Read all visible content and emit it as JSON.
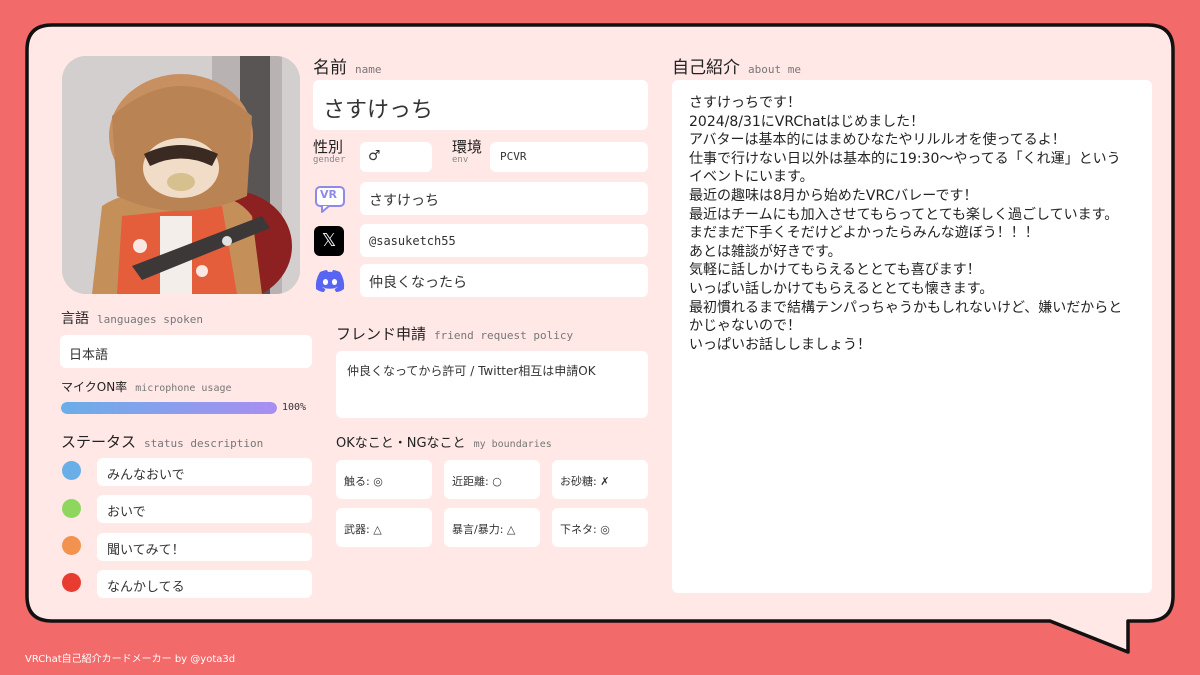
{
  "profile": {
    "name_label": "名前",
    "name_label_en": "name",
    "name_value": "さすけっち",
    "gender_label": "性別",
    "gender_label_en": "gender",
    "gender_value": "♂",
    "env_label": "環境",
    "env_label_en": "env",
    "env_value": "PCVR",
    "vrchat_icon_text": "VR",
    "vrchat_name": "さすけっち",
    "x_icon_text": "𝕏",
    "twitter_handle": "@sasuketch55",
    "discord_value": "仲良くなったら"
  },
  "languages": {
    "label": "言語",
    "label_en": "languages spoken",
    "value": "日本語"
  },
  "microphone": {
    "label": "マイクON率",
    "label_en": "microphone usage",
    "percent": 100,
    "percent_text": "100%"
  },
  "status": {
    "label": "ステータス",
    "label_en": "status description",
    "items": [
      {
        "text": "みんなおいで",
        "color": "#6aaee8"
      },
      {
        "text": "おいで",
        "color": "#8fd65f"
      },
      {
        "text": "聞いてみて！",
        "color": "#f2924e"
      },
      {
        "text": "なんかしてる",
        "color": "#e83c30"
      }
    ]
  },
  "friend_request": {
    "label": "フレンド申請",
    "label_en": "friend request policy",
    "value": "仲良くなってから許可 / Twitter相互は申請OK"
  },
  "boundaries": {
    "label": "OKなこと・NGなこと",
    "label_en": "my boundaries",
    "items": [
      {
        "text": "触る: ◎"
      },
      {
        "text": "近距離: ○"
      },
      {
        "text": "お砂糖: ✗"
      },
      {
        "text": "武器: △"
      },
      {
        "text": "暴言/暴力: △"
      },
      {
        "text": "下ネタ: ◎"
      }
    ]
  },
  "about": {
    "label": "自己紹介",
    "label_en": "about me",
    "text": "さすけっちです！\n2024/8/31にVRChatはじめました！\nアバターは基本的にはまめひなたやリルルオを使ってるよ！\n仕事で行けない日以外は基本的に19:30～やってる「くれ運」というイベントにいます。\n最近の趣味は8月から始めたVRCバレーです！\n最近はチームにも加入させてもらってとても楽しく過ごしています。\nまだまだ下手くそだけどよかったらみんな遊ぼう！！！\nあとは雑談が好きです。\n気軽に話しかけてもらえるととても喜びます！\nいっぱい話しかけてもらえるととても懐きます。\n最初慣れるまで結構テンパっちゃうかもしれないけど、嫌いだからとかじゃないので！\nいっぱいお話ししましょう！"
  },
  "footer": "VRChat自己紹介カードメーカー by @yota3d",
  "colors": {
    "background": "#f26a6a",
    "card": "#ffe8e6",
    "vrchat_icon": "#8f8ae8",
    "discord": "#5865f2",
    "mic_start": "#6aaee8",
    "mic_end": "#a98ef2"
  }
}
